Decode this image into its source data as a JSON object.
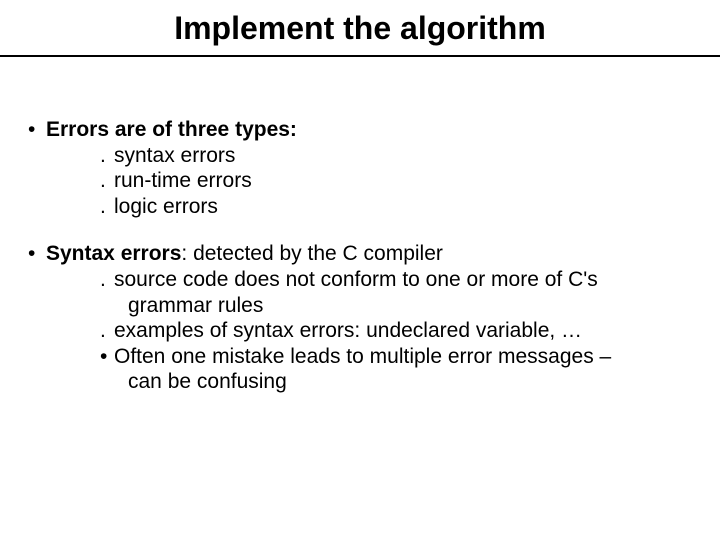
{
  "title": "Implement the algorithm",
  "block1": {
    "heading_prefix": "Errors are of three types:",
    "items": [
      "syntax errors",
      "run-time errors",
      "logic errors"
    ]
  },
  "block2": {
    "heading_bold": "Syntax errors",
    "heading_rest": ": detected by the C compiler",
    "line1a": "source code does not conform to one or more of C's",
    "line1b": "grammar rules",
    "line2": "examples of syntax errors: undeclared variable, …",
    "line3a": "Often one mistake leads to multiple error messages –",
    "line3b": "can be confusing"
  }
}
